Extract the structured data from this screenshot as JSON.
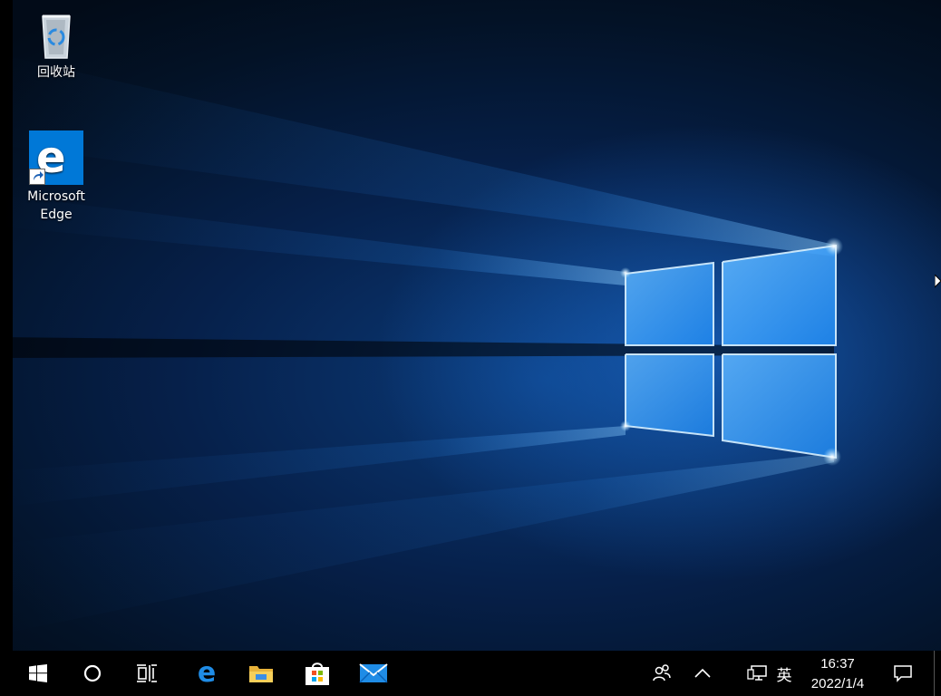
{
  "desktop": {
    "icons": [
      {
        "label": "回收站",
        "icon": "recycle-bin-icon"
      },
      {
        "label_line1": "Microsoft",
        "label_line2": "Edge",
        "icon": "edge-icon"
      }
    ]
  },
  "taskbar": {
    "start": "windows-start-icon",
    "search": "cortana-circle-icon",
    "task_view": "task-view-icon",
    "pinned": [
      "edge-icon",
      "file-explorer-icon",
      "store-icon",
      "mail-icon"
    ],
    "tray": {
      "people": "people-icon",
      "chevron": "chevron-up-icon",
      "network": "network-icon",
      "ime": "英",
      "time": "16:37",
      "date": "2022/1/4",
      "notifications": "action-center-icon"
    }
  },
  "colors": {
    "accent": "#0078d7",
    "taskbar": "#000000"
  }
}
